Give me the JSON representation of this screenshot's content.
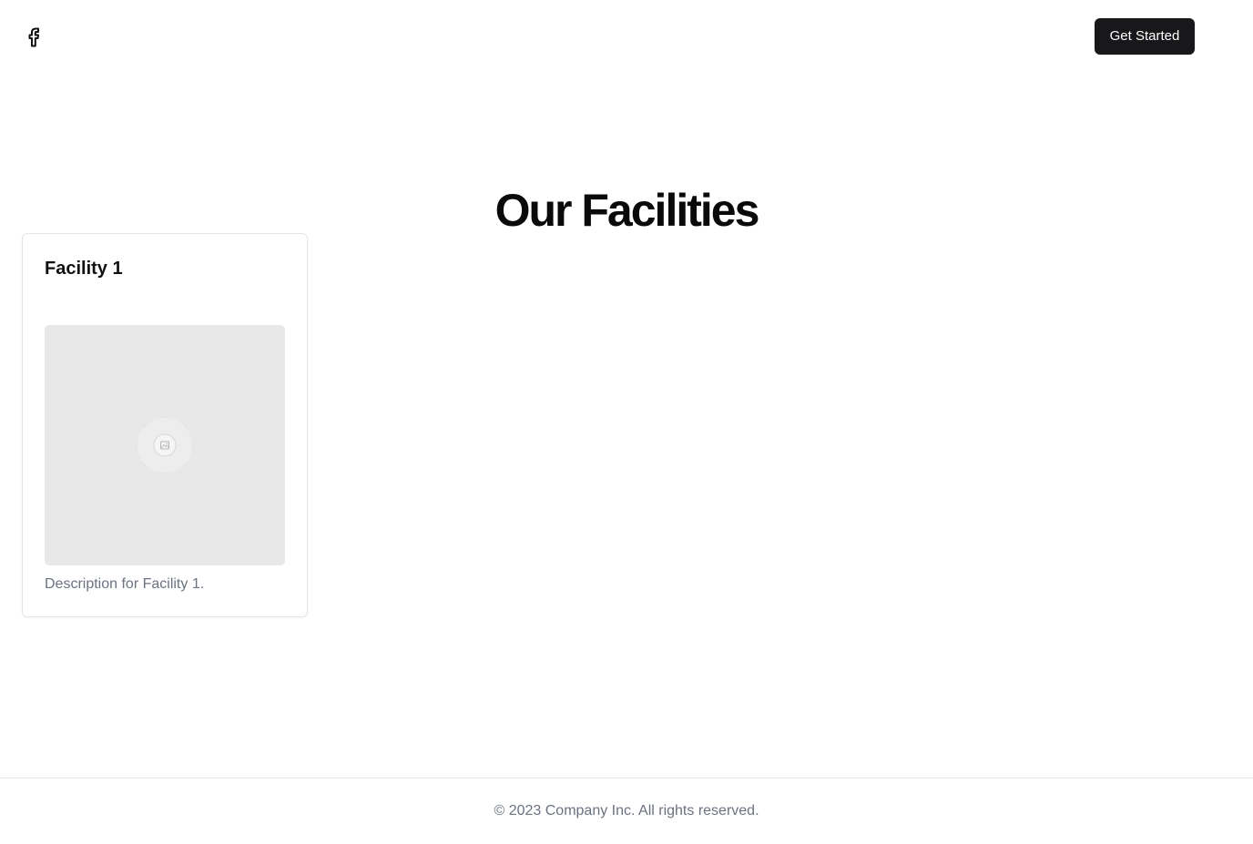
{
  "header": {
    "logo_icon": "facebook-icon",
    "cta_label": "Get Started"
  },
  "section": {
    "title": "Our Facilities"
  },
  "facilities": [
    {
      "title": "Facility 1",
      "image_icon": "image-placeholder-icon",
      "description": "Description for Facility 1."
    }
  ],
  "footer": {
    "copyright": "© 2023 Company Inc. All rights reserved."
  },
  "colors": {
    "button_bg": "#18181b",
    "button_text": "#ffffff",
    "muted_text": "#6b7280",
    "placeholder_bg": "#e8e8e8",
    "border": "#e5e5e5"
  }
}
